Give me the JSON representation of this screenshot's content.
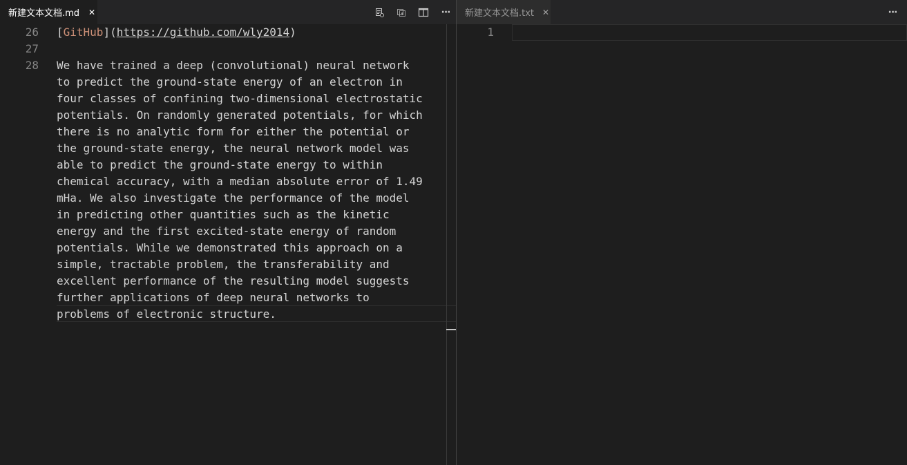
{
  "left_group": {
    "tab": {
      "label": "新建文本文档.md",
      "close": "✕"
    },
    "actions": [
      {
        "name": "open-changes-icon"
      },
      {
        "name": "open-preview-icon"
      },
      {
        "name": "split-editor-icon"
      },
      {
        "name": "more-actions-icon",
        "glyph": "···"
      }
    ],
    "lines": [
      {
        "number": "26",
        "link_open": "[",
        "link_text": "GitHub",
        "link_close": "](",
        "url": "https://github.com/wly2014",
        "paren_close": ")"
      },
      {
        "number": "27",
        "text": ""
      },
      {
        "number": "28",
        "wrapped": [
          "We have trained a deep (convolutional) neural network",
          "to predict the ground-state energy of an electron in",
          "four classes of confining two-dimensional electrostatic",
          "potentials. On randomly generated potentials, for which",
          "there is no analytic form for either the potential or",
          "the ground-state energy, the neural network model was",
          "able to predict the ground-state energy to within",
          "chemical accuracy, with a median absolute error of 1.49",
          "mHa. We also investigate the performance of the model",
          "in predicting other quantities such as the kinetic",
          "energy and the first excited-state energy of random",
          "potentials. While we demonstrated this approach on a",
          "simple, tractable problem, the transferability and",
          "excellent performance of the resulting model suggests",
          "further applications of deep neural networks to",
          "problems of electronic structure."
        ]
      }
    ]
  },
  "right_group": {
    "tab": {
      "label": "新建文本文档.txt",
      "close": "✕"
    },
    "actions": [
      {
        "name": "more-actions-icon",
        "glyph": "···"
      }
    ],
    "lines": [
      {
        "number": "1",
        "text": ""
      }
    ]
  },
  "colors": {
    "editor_bg": "#1e1e1e",
    "tabbar_bg": "#252526",
    "inactive_tab_bg": "#2d2d2d",
    "line_number": "#858585",
    "text": "#d4d4d4",
    "link_text": "#ce9178"
  }
}
